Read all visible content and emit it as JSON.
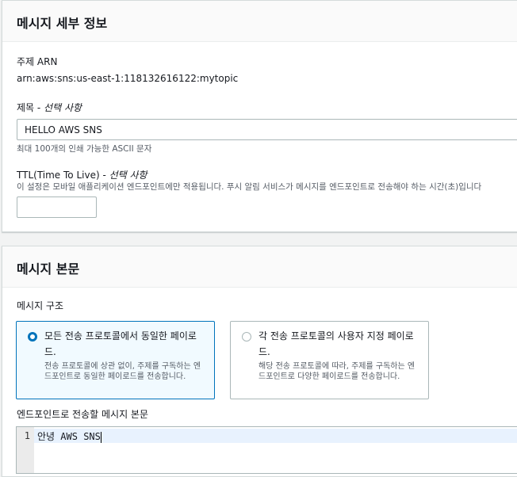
{
  "details": {
    "title": "메시지 세부 정보",
    "arn_label": "주제 ARN",
    "arn_value": "arn:aws:sns:us-east-1:118132616122:mytopic",
    "subject_label": "제목 - ",
    "subject_optional": "선택 사항",
    "subject_value": "HELLO AWS SNS",
    "subject_hint": "최대 100개의 인쇄 가능한 ASCII 문자",
    "ttl_label": "TTL(Time To Live) - ",
    "ttl_optional": "선택 사항",
    "ttl_desc": "이 설정은 모바일 애플리케이션 엔드포인트에만 적용됩니다. 푸시 알림 서비스가 메시지를 엔드포인트로 전송해야 하는 시간(초)입니다",
    "ttl_value": ""
  },
  "body": {
    "title": "메시지 본문",
    "structure_label": "메시지 구조",
    "options": [
      {
        "title": "모든 전송 프로토콜에서 동일한 페이로드.",
        "desc": "전송 프로토콜에 상관 없이, 주제를 구독하는 엔드포인트로 동일한 페이로드를 전송합니다.",
        "selected": true
      },
      {
        "title": "각 전송 프로토콜의 사용자 지정 페이로드.",
        "desc": "해당 전송 프로토콜에 따라, 주제를 구독하는 엔드포인트로 다양한 페이로드를 전송합니다.",
        "selected": false
      }
    ],
    "editor_label": "엔드포인트로 전송할 메시지 본문",
    "editor_line_number": "1",
    "editor_content": "안녕 AWS SNS"
  },
  "colors": {
    "accent": "#0073bb",
    "selected_tile_bg": "#f1faff",
    "page_bg": "#f2f3f3"
  }
}
